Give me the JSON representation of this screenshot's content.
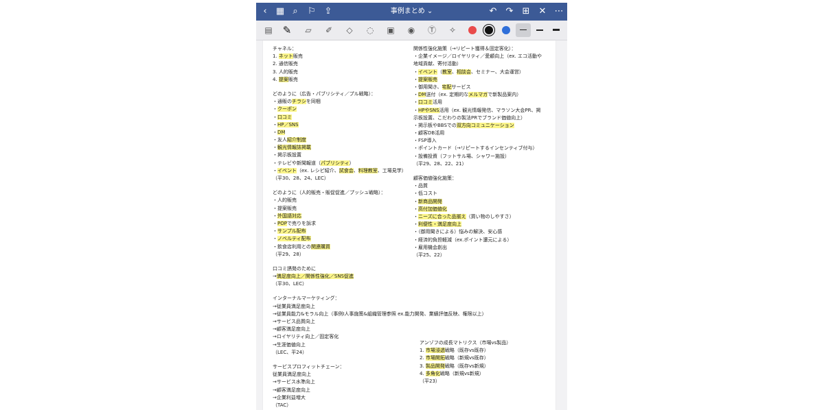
{
  "app": {
    "doc_title": "事例まとめ",
    "nav_icons": [
      "back-icon",
      "grid-icon",
      "search-icon",
      "bookmark-icon",
      "share-icon"
    ],
    "right_icons": [
      "undo-icon",
      "redo-icon",
      "add-page-icon",
      "close-icon",
      "more-icon"
    ]
  },
  "toolbar": {
    "tools": [
      "read-mode-icon",
      "pen-icon",
      "eraser-icon",
      "highlighter-icon",
      "shape-icon",
      "lasso-icon",
      "image-icon",
      "camera-icon",
      "text-icon",
      "laser-icon"
    ],
    "colors": [
      "#e94b4b",
      "#111111",
      "#2f6fd9"
    ]
  },
  "left": {
    "b1": [
      [
        [
          "チャネル：",
          0
        ]
      ],
      [
        [
          "1. ",
          0
        ],
        [
          "ネット",
          1
        ],
        [
          "販売",
          0
        ]
      ],
      [
        [
          "2. 通信販売",
          0
        ]
      ],
      [
        [
          "3. 人的販売",
          0
        ]
      ],
      [
        [
          "4. ",
          0
        ],
        [
          "提案",
          1
        ],
        [
          "販売",
          0
        ]
      ]
    ],
    "b2": [
      [
        [
          "どのように（広告・パブリシティ／プル戦略）：",
          0
        ]
      ],
      [
        [
          "・通販の",
          0
        ],
        [
          "チラシ",
          1
        ],
        [
          "を同梱",
          0
        ]
      ],
      [
        [
          "・",
          0
        ],
        [
          "クーポン",
          1
        ]
      ],
      [
        [
          "・",
          0
        ],
        [
          "口コミ",
          1
        ]
      ],
      [
        [
          "・",
          0
        ],
        [
          "HP／SNS",
          1
        ]
      ],
      [
        [
          "・",
          0
        ],
        [
          "DM",
          1
        ]
      ],
      [
        [
          "・友人",
          0
        ],
        [
          "紹介制度",
          1
        ]
      ],
      [
        [
          "・",
          0
        ],
        [
          "観光情報誌掲載",
          1
        ]
      ],
      [
        [
          "・掲示板設置",
          0
        ]
      ],
      [
        [
          "・テレビや新聞報道（",
          0
        ],
        [
          "パブリシティ",
          1
        ],
        [
          "）",
          0
        ]
      ],
      [
        [
          "・",
          0
        ],
        [
          "イベント",
          1
        ],
        [
          "（ex. レシピ紹介、",
          0
        ],
        [
          "試食会",
          1
        ],
        [
          "、",
          0
        ],
        [
          "料理教室",
          1
        ],
        [
          "、工場見学）",
          0
        ]
      ],
      [
        [
          "（平30、28、24、LEC）",
          0
        ]
      ]
    ],
    "b3": [
      [
        [
          "どのように（人的販売・販促促進／プッシュ戦略）：",
          0
        ]
      ],
      [
        [
          "・人的販売",
          0
        ]
      ],
      [
        [
          "・提案販売",
          0
        ]
      ],
      [
        [
          "・",
          0
        ],
        [
          "外国語対応",
          1
        ]
      ],
      [
        [
          "・",
          0
        ],
        [
          "POP",
          1
        ],
        [
          "で売りを訴求",
          0
        ]
      ],
      [
        [
          "・",
          0
        ],
        [
          "サンプル配布",
          1
        ]
      ],
      [
        [
          "・",
          0
        ],
        [
          "ノベルティ配布",
          1
        ]
      ],
      [
        [
          "・飲食店利用との",
          0
        ],
        [
          "関連購買",
          1
        ]
      ],
      [
        [
          "（平29、28）",
          0
        ]
      ]
    ],
    "b4": [
      [
        [
          "口コミ誘発のために",
          0
        ]
      ],
      [
        [
          "→",
          0
        ],
        [
          "満足度向上／関係性強化／SNS促進",
          1
        ]
      ],
      [
        [
          "（平30、LEC）",
          0
        ]
      ]
    ],
    "b5": [
      [
        [
          "インターナルマーケティング：",
          0
        ]
      ],
      [
        [
          "→従業員満足度向上",
          0
        ]
      ],
      [
        [
          "→従業員能力&モラル向上（事例Ⅰ人事施策&組織管理参照 ex.能力開発、業績評価反映、権限以上）",
          0
        ]
      ],
      [
        [
          "→サービス品質向上",
          0
        ]
      ],
      [
        [
          "→顧客満足度向上",
          0
        ]
      ],
      [
        [
          "→ロイヤリティ向上／固定客化",
          0
        ]
      ],
      [
        [
          "→生涯価値向上",
          0
        ]
      ],
      [
        [
          "（LEC、平24）",
          0
        ]
      ]
    ],
    "b6": [
      [
        [
          "サービスプロフィットチェーン：",
          0
        ]
      ],
      [
        [
          "従業員満足度向上",
          0
        ]
      ],
      [
        [
          "→サービス水準向上",
          0
        ]
      ],
      [
        [
          "→顧客満足度向上",
          0
        ]
      ],
      [
        [
          "→企業利益増大",
          0
        ]
      ],
      [
        [
          "（TAC）",
          0
        ]
      ]
    ]
  },
  "right": {
    "b1": [
      [
        [
          "関係性強化施策（→リピート獲得＆固定客化）：",
          0
        ]
      ],
      [
        [
          "・企業イメージ／ロイヤリティ／愛顧向上（ex. エコ活動や",
          0
        ]
      ],
      [
        [
          "地域貢献、寄付活動）",
          0
        ]
      ],
      [
        [
          "・",
          0
        ],
        [
          "イベント",
          1
        ],
        [
          "（",
          0
        ],
        [
          "教室",
          1
        ],
        [
          "、",
          0
        ],
        [
          "相談会",
          1
        ],
        [
          "、セミナー、大会運営）",
          0
        ]
      ],
      [
        [
          "・",
          0
        ],
        [
          "提案販売",
          1
        ]
      ],
      [
        [
          "・御用聞き、",
          0
        ],
        [
          "宅配",
          1
        ],
        [
          "サービス",
          0
        ]
      ],
      [
        [
          "・",
          0
        ],
        [
          "DM",
          1
        ],
        [
          "送付（ex. 定期的な",
          0
        ],
        [
          "メルマガ",
          1
        ],
        [
          "で新製品案内）",
          0
        ]
      ],
      [
        [
          "・",
          0
        ],
        [
          "口コミ",
          1
        ],
        [
          "活用",
          0
        ]
      ],
      [
        [
          "・",
          0
        ],
        [
          "HPやSNS",
          1
        ],
        [
          "活用（ex. 観光情報発信、マラソン大会PR、掲",
          0
        ]
      ],
      [
        [
          "示板設置、こだわりの製法PRでブランド価値向上）",
          0
        ]
      ],
      [
        [
          "・掲示板やBBSでの",
          0
        ],
        [
          "双方向コミュニケーション",
          1
        ]
      ],
      [
        [
          "・顧客DB活用",
          0
        ]
      ],
      [
        [
          "・FSP導入",
          0
        ]
      ],
      [
        [
          "・ポイントカード（→リピートするインセンティブ付与）",
          0
        ]
      ],
      [
        [
          "・設備投資（フットサル場、シャワー施設）",
          0
        ]
      ],
      [
        [
          "（平29、28、22、21）",
          0
        ]
      ]
    ],
    "b2": [
      [
        [
          "顧客価値強化施策：",
          0
        ]
      ],
      [
        [
          "・品質",
          0
        ]
      ],
      [
        [
          "・低コスト",
          0
        ]
      ],
      [
        [
          "・",
          0
        ],
        [
          "新商品開発",
          1
        ]
      ],
      [
        [
          "・",
          0
        ],
        [
          "高付加価値化",
          1
        ]
      ],
      [
        [
          "・",
          0
        ],
        [
          "ニーズに合った品揃え",
          1
        ],
        [
          "（買い物のしやすさ）",
          0
        ]
      ],
      [
        [
          "・",
          0
        ],
        [
          "利便性・満足度向上",
          1
        ]
      ],
      [
        [
          "・（御用聞きによる）悩みの解決、安心感",
          0
        ]
      ],
      [
        [
          "・経済的負担軽減（ex.ポイント還元による）",
          0
        ]
      ],
      [
        [
          "・雇用機会創出",
          0
        ]
      ],
      [
        [
          "（平25、22）",
          0
        ]
      ]
    ],
    "b3": [
      [
        [
          "アンゾフの成長マトリクス（市場vs製品）",
          0
        ]
      ],
      [
        [
          "1. ",
          0
        ],
        [
          "市場浸透",
          1
        ],
        [
          "戦略（既存vs既存）",
          0
        ]
      ],
      [
        [
          "2. ",
          0
        ],
        [
          "市場開拓",
          1
        ],
        [
          "戦略（新規vs既存）",
          0
        ]
      ],
      [
        [
          "3. ",
          0
        ],
        [
          "製品開発",
          1
        ],
        [
          "戦略（既存vs新規）",
          0
        ]
      ],
      [
        [
          "4. ",
          0
        ],
        [
          "多角化",
          1
        ],
        [
          "戦略（新規vs新規）",
          0
        ]
      ],
      [
        [
          "（平23）",
          0
        ]
      ]
    ]
  }
}
